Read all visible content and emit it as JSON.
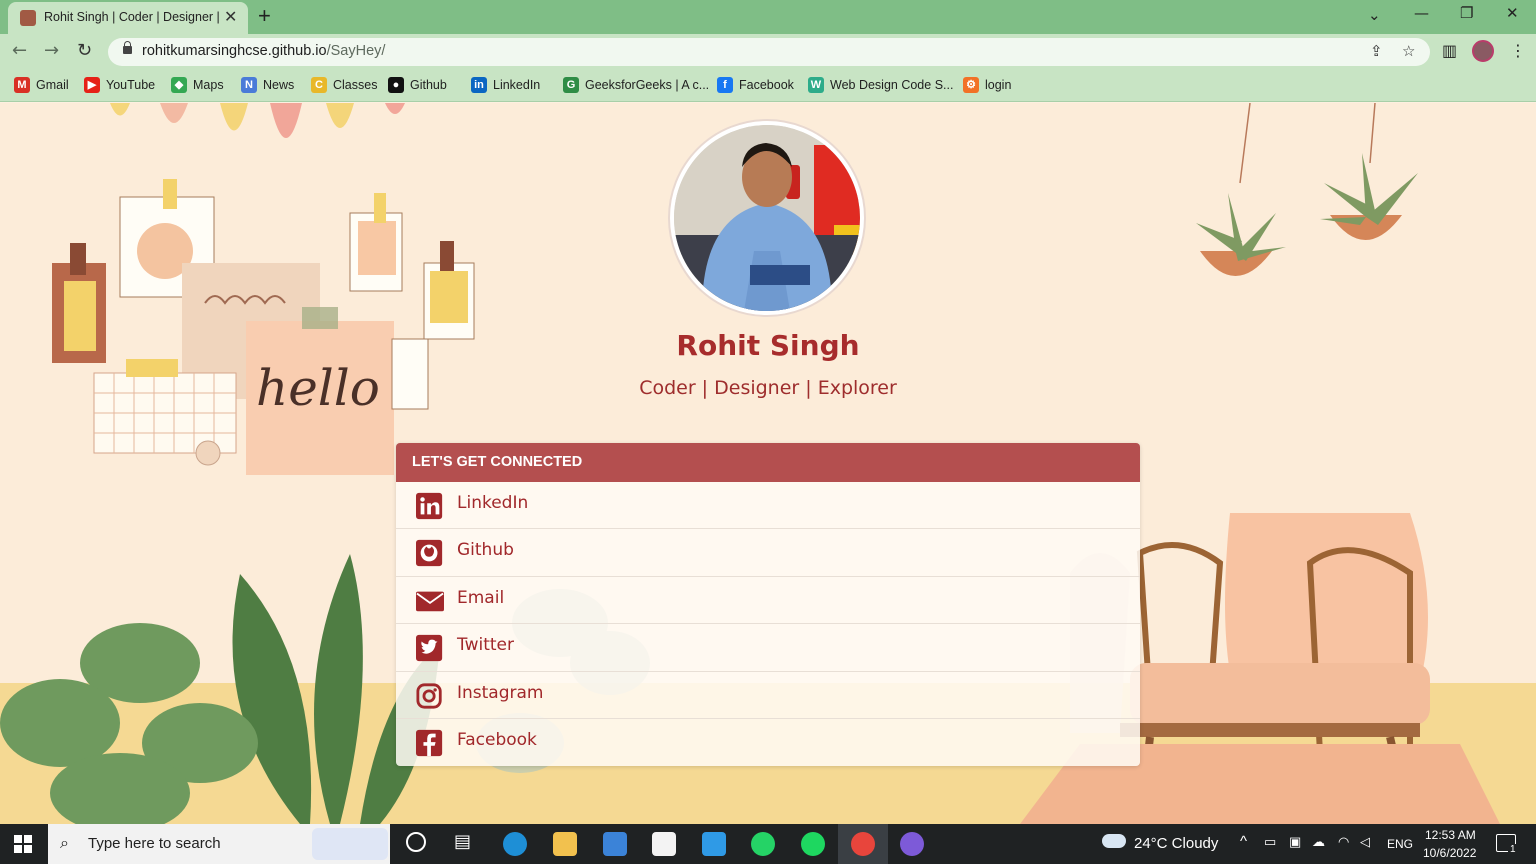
{
  "browser": {
    "tab_title": "Rohit Singh | Coder | Designer | Explorer",
    "tab_close": "✕",
    "new_tab": "+",
    "url_host": "rohitkumarsinghcse.github.io",
    "url_path": "/SayHey/",
    "bookmarks": [
      {
        "label": "Gmail",
        "icon": "gmail-icon",
        "color": "#d93025"
      },
      {
        "label": "YouTube",
        "icon": "youtube-icon",
        "color": "#e62117"
      },
      {
        "label": "Maps",
        "icon": "maps-icon",
        "color": "#34a853"
      },
      {
        "label": "News",
        "icon": "news-icon",
        "color": "#4a7bd8"
      },
      {
        "label": "Classes",
        "icon": "classes-icon",
        "color": "#e8b82a"
      },
      {
        "label": "Github",
        "icon": "github-icon",
        "color": "#111111"
      },
      {
        "label": "LinkedIn",
        "icon": "linkedin-icon",
        "color": "#0a66c2"
      },
      {
        "label": "GeeksforGeeks | A c...",
        "icon": "geeksforgeeks-icon",
        "color": "#2f8d46"
      },
      {
        "label": "Facebook",
        "icon": "facebook-icon",
        "color": "#1877f2"
      },
      {
        "label": "Web Design Code S...",
        "icon": "web-design-icon",
        "color": "#2dac8a"
      },
      {
        "label": "login",
        "icon": "login-icon",
        "color": "#f27127"
      }
    ]
  },
  "profile": {
    "name": "Rohit Singh",
    "tagline": "Coder | Designer | Explorer"
  },
  "connect": {
    "header": "LET'S GET CONNECTED",
    "links": [
      {
        "label": "LinkedIn",
        "icon": "linkedin-icon"
      },
      {
        "label": "Github",
        "icon": "github-icon"
      },
      {
        "label": "Email",
        "icon": "email-icon"
      },
      {
        "label": "Twitter",
        "icon": "twitter-icon"
      },
      {
        "label": "Instagram",
        "icon": "instagram-icon"
      },
      {
        "label": "Facebook",
        "icon": "facebook-icon"
      }
    ]
  },
  "decor": {
    "note_text": "hello"
  },
  "taskbar": {
    "search_placeholder": "Type here to search",
    "weather": "24°C  Cloudy",
    "language": "ENG",
    "time": "12:53 AM",
    "date": "10/6/2022",
    "notifications": "1"
  },
  "colors": {
    "accent": "#b44f4f",
    "link_text": "#a1282b",
    "page_bg": "#fcecd9",
    "chrome_green": "#7fbe86"
  }
}
